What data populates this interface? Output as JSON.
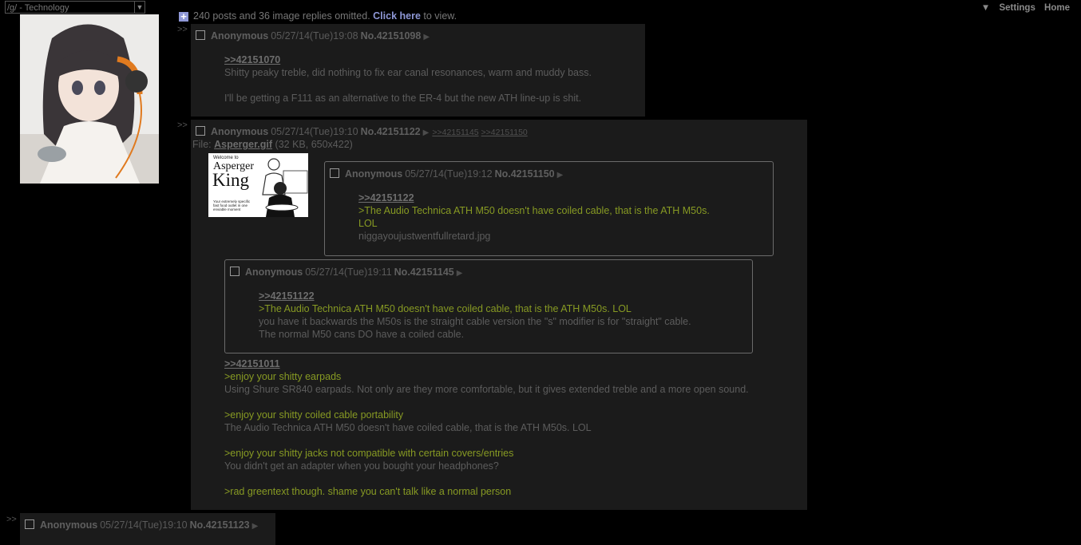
{
  "board_select": {
    "label": "/g/ - Technology"
  },
  "omitted": {
    "prefix": "240 posts and 36 image replies omitted.",
    "link": "Click here",
    "suffix": "to view."
  },
  "topnav": {
    "arrow": "▼",
    "settings": "Settings",
    "home": "Home"
  },
  "colors": {
    "bg": "#000000",
    "post_bg": "#1b1b1b",
    "greentext": "#879a23",
    "link": "#8e97d6"
  },
  "posts": {
    "p42151098": {
      "arrows": ">>",
      "name": "Anonymous",
      "date": "05/27/14(Tue)19:08",
      "no": "No.42151098",
      "menu": "▶",
      "quote": ">>42151070",
      "line1": "Shitty peaky treble, did nothing to fix ear canal resonances, warm and muddy bass.",
      "line2": "I'll be getting a F111 as an alternative to the ER-4 but the new ATH line-up is shit."
    },
    "p42151122": {
      "arrows": ">>",
      "name": "Anonymous",
      "date": "05/27/14(Tue)19:10",
      "no": "No.42151122",
      "menu": "▶",
      "backlinks": [
        ">>42151145",
        ">>42151150"
      ],
      "file_prefix": "File:",
      "file_name": "Asperger.gif",
      "file_meta": "(32 KB, 650x422)",
      "thumb": {
        "top_small": "Welcome to",
        "title1": "Asperger",
        "title2": "King",
        "caption": "Your extremely specific fast food outlet in one enviable moment"
      },
      "quote": ">>42151011",
      "g1": ">enjoy your shitty earpads",
      "t1": "Using Shure SR840 earpads. Not only are they more comfortable, but it gives extended treble and a more open sound.",
      "g2": ">enjoy your shitty coiled cable portability",
      "t2": "The Audio Technica ATH M50 doesn't have coiled cable, that is the ATH M50s. LOL",
      "g3": ">enjoy your shitty jacks not compatible with certain covers/entries",
      "t3": "You didn't get an adapter when you bought your headphones?",
      "g4": ">rad greentext though. shame you can't talk like a normal person"
    },
    "p42151150": {
      "name": "Anonymous",
      "date": "05/27/14(Tue)19:12",
      "no": "No.42151150",
      "menu": "▶",
      "quote": ">>42151122",
      "g1": ">The Audio Technica ATH M50 doesn't have coiled cable, that is the ATH M50s.",
      "g2": "LOL",
      "t1": "niggayoujustwentfullretard.jpg"
    },
    "p42151145": {
      "name": "Anonymous",
      "date": "05/27/14(Tue)19:11",
      "no": "No.42151145",
      "menu": "▶",
      "quote": ">>42151122",
      "g1": ">The Audio Technica ATH M50 doesn't have coiled cable, that is the ATH M50s. LOL",
      "t1": "you have it backwards the M50s is the straight cable version the \"s\" modifier is for \"straight\" cable.",
      "t2": "The normal M50 cans DO have a coiled cable."
    },
    "p42151123": {
      "arrows": ">>",
      "name": "Anonymous",
      "date": "05/27/14(Tue)19:10",
      "no": "No.42151123",
      "menu": "▶"
    }
  }
}
